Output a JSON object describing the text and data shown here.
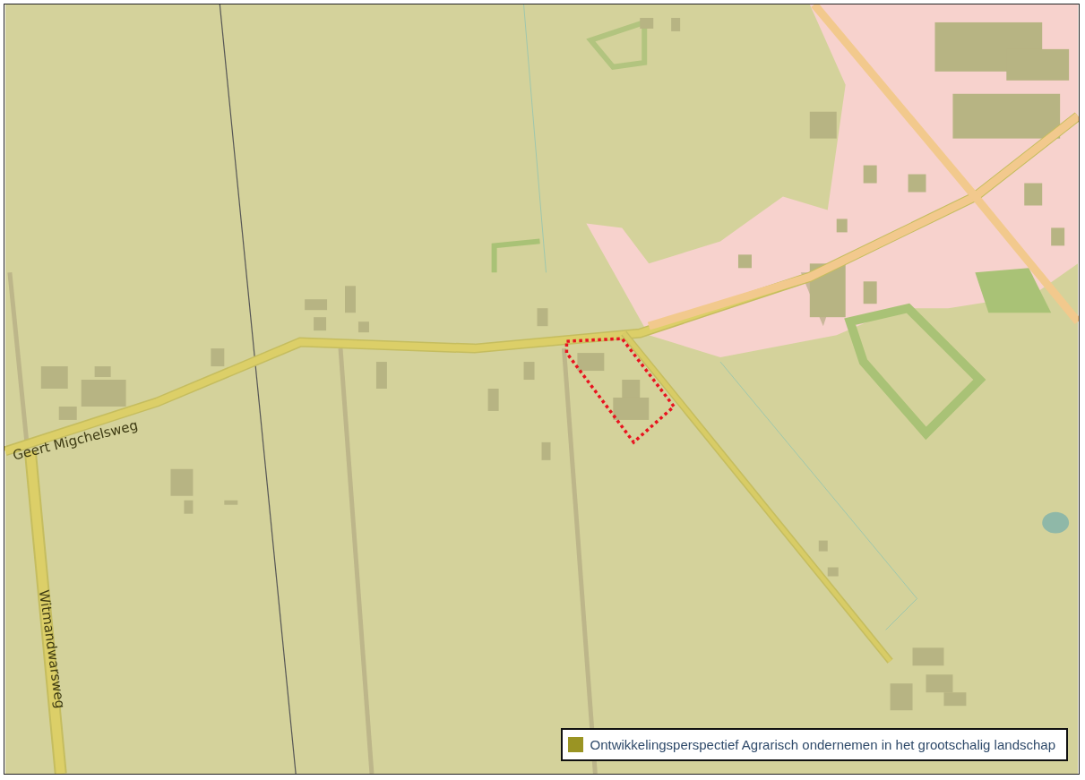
{
  "map": {
    "road_labels": [
      {
        "text": "Geert Migchelsweg",
        "kind": "horizontal"
      },
      {
        "text": "Witmandwarsweg",
        "kind": "vertical"
      }
    ]
  },
  "legend": {
    "items": [
      {
        "label": "Ontwikkelingsperspectief Agrarisch ondernemen in het grootschalig landschap",
        "color": "#9a9423"
      }
    ]
  }
}
